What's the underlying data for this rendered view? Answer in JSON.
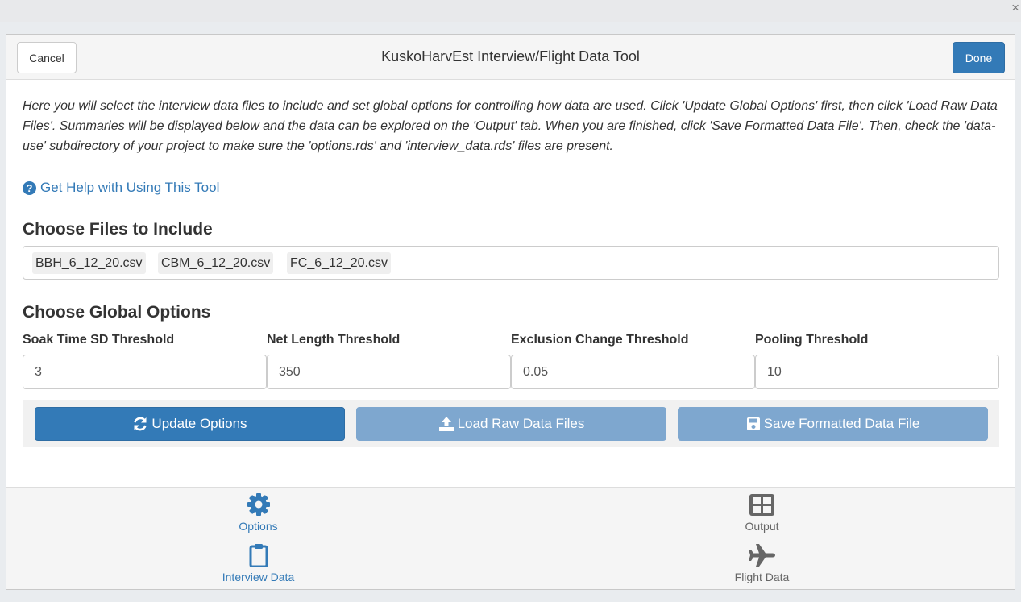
{
  "gadget": {
    "title": "KuskoHarvEst Interview/Flight Data Tool",
    "cancel_label": "Cancel",
    "done_label": "Done"
  },
  "intro_text": "Here you will select the interview data files to include and set global options for controlling how data are used. Click 'Update Global Options' first, then click 'Load Raw Data Files'. Summaries will be displayed below and the data can be explored on the 'Output' tab. When you are finished, click 'Save Formatted Data File'. Then, check the 'data-use' subdirectory of your project to make sure the 'options.rds' and 'interview_data.rds' files are present.",
  "help_link": "Get Help with Using This Tool",
  "files_section": {
    "title": "Choose Files to Include",
    "files": [
      "BBH_6_12_20.csv",
      "CBM_6_12_20.csv",
      "FC_6_12_20.csv"
    ]
  },
  "options_section": {
    "title": "Choose Global Options",
    "fields": [
      {
        "label": "Soak Time SD Threshold",
        "value": "3"
      },
      {
        "label": "Net Length Threshold",
        "value": "350"
      },
      {
        "label": "Exclusion Change Threshold",
        "value": "0.05"
      },
      {
        "label": "Pooling Threshold",
        "value": "10"
      }
    ]
  },
  "actions": {
    "update": "Update Options",
    "load": "Load Raw Data Files",
    "save": "Save Formatted Data File"
  },
  "tabs": [
    {
      "label": "Options",
      "icon": "gear-icon",
      "active": true
    },
    {
      "label": "Output",
      "icon": "table-icon",
      "active": false
    },
    {
      "label": "Interview Data",
      "icon": "clipboard-icon",
      "active": true
    },
    {
      "label": "Flight Data",
      "icon": "plane-icon",
      "active": false
    }
  ],
  "colors": {
    "primary": "#337ab7",
    "primary_disabled": "#7ea7cf",
    "inactive_tab": "#666666"
  }
}
